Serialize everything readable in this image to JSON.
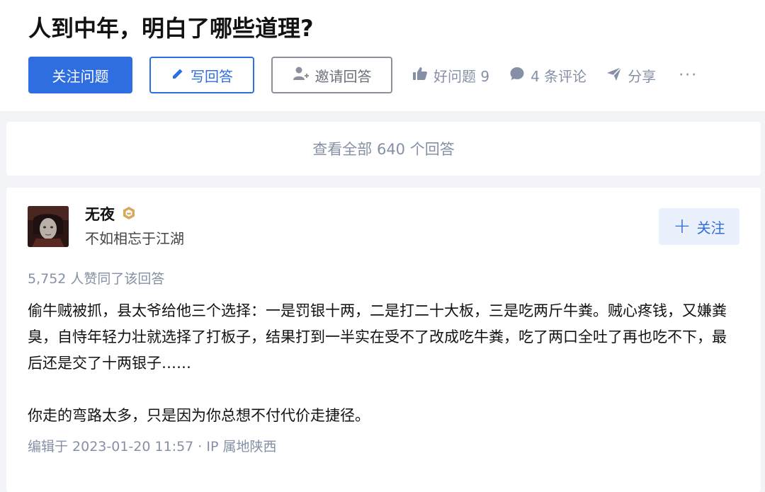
{
  "question": {
    "title": "人到中年，明白了哪些道理?"
  },
  "actions": {
    "follow_label": "关注问题",
    "write_label": "写回答",
    "invite_label": "邀请回答",
    "good_question_label": "好问题 9",
    "comments_label": "4 条评论",
    "share_label": "分享",
    "more_label": "···"
  },
  "view_all": {
    "label": "查看全部 640 个回答"
  },
  "answer": {
    "author_name": "无夜",
    "author_bio": "不如相忘于江湖",
    "follow_label": "关注",
    "vote_summary": "5,752 人赞同了该回答",
    "paragraphs": [
      "偷牛贼被抓，县太爷给他三个选择：一是罚银十两，二是打二十大板，三是吃两斤牛粪。贼心疼钱，又嫌粪臭，自恃年轻力壮就选择了打板子，结果打到一半实在受不了改成吃牛粪，吃了两口全吐了再也吃不下，最后还是交了十两银子……",
      "你走的弯路太多，只是因为你总想不付代价走捷径。"
    ],
    "edit_time": "编辑于 2023-01-20 11:57 · IP 属地陕西"
  },
  "colors": {
    "brand_blue": "#2f6ee0",
    "muted_text": "#8590a6",
    "badge_gold": "#d6a85b"
  },
  "icons": {
    "write": "pencil-icon",
    "invite": "add-user-icon",
    "good_question": "thumbs-up-icon",
    "comments": "comment-bubble-icon",
    "share": "paper-plane-icon",
    "badge": "hexagon-badge-icon",
    "plus": "plus-icon"
  }
}
